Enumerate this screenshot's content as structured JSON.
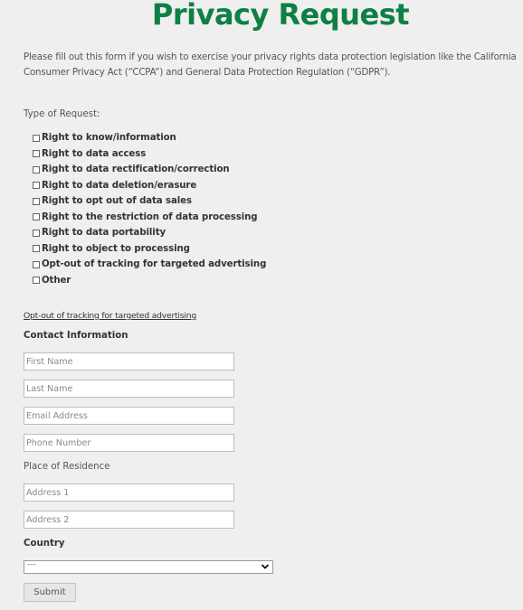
{
  "page": {
    "title": "Privacy Request",
    "intro": "Please fill out this form if you wish to exercise your privacy rights data protection legislation like the California Consumer Privacy Act (“CCPA”) and General Data Protection Regulation (“GDPR”)."
  },
  "request_types": {
    "label": "Type of Request:",
    "options": [
      {
        "label": "Right to know/information",
        "checked": false
      },
      {
        "label": "Right to data access",
        "checked": false
      },
      {
        "label": "Right to data rectification/correction",
        "checked": false
      },
      {
        "label": "Right to data deletion/erasure",
        "checked": false
      },
      {
        "label": "Right to opt out of data sales",
        "checked": false
      },
      {
        "label": "Right to the restriction of data processing",
        "checked": false
      },
      {
        "label": "Right to data portability",
        "checked": false
      },
      {
        "label": "Right to object to processing",
        "checked": false
      },
      {
        "label": "Opt-out of tracking for targeted advertising",
        "checked": false
      },
      {
        "label": "Other",
        "checked": false
      }
    ]
  },
  "optout_link": "Opt-out of tracking for targeted advertising",
  "contact": {
    "heading": "Contact Information",
    "first_name": {
      "placeholder": "First Name",
      "value": ""
    },
    "last_name": {
      "placeholder": "Last Name",
      "value": ""
    },
    "email": {
      "placeholder": "Email Address",
      "value": ""
    },
    "phone": {
      "placeholder": "Phone Number",
      "value": ""
    }
  },
  "residence": {
    "label": "Place of Residence",
    "address1": {
      "placeholder": "Address 1",
      "value": ""
    },
    "address2": {
      "placeholder": "Address 2",
      "value": ""
    }
  },
  "country": {
    "heading": "Country",
    "selected": "---",
    "icon": "chevron-down-icon"
  },
  "submit_label": "Submit"
}
